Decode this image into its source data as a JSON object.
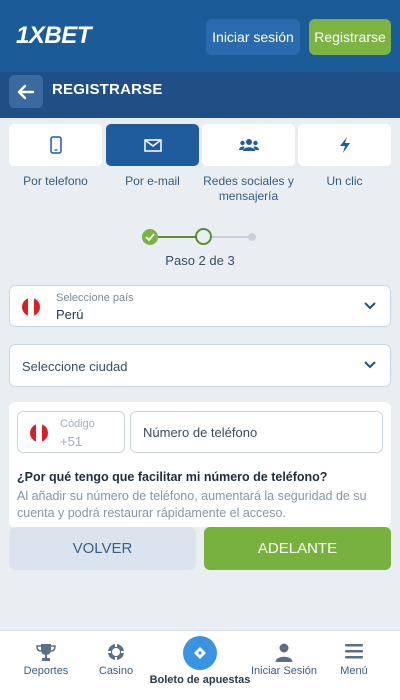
{
  "header": {
    "logo": "1XBET",
    "login_label": "Iniciar sesión",
    "register_label": "Registrarse"
  },
  "titlebar": {
    "title": "REGISTRARSE"
  },
  "tabs": [
    {
      "label": "Por telefono",
      "icon": "phone-icon",
      "active": false
    },
    {
      "label": "Por e-mail",
      "icon": "envelope-icon",
      "active": true
    },
    {
      "label": "Redes sociales y mensajería",
      "icon": "users-icon",
      "active": false
    },
    {
      "label": "Un clic",
      "icon": "lightning-icon",
      "active": false
    }
  ],
  "stepper": {
    "text": "Paso 2 de 3",
    "current": 2,
    "total": 3
  },
  "country": {
    "label": "Seleccione país",
    "value": "Perú"
  },
  "city": {
    "placeholder": "Seleccione ciudad"
  },
  "phone": {
    "code_label": "Código",
    "code_value": "+51",
    "number_placeholder": "Número de teléfono",
    "why_title": "¿Por qué tengo que facilitar mi número de teléfono?",
    "why_text": "Al añadir su número de teléfono, aumentará la seguridad de su cuenta y podrá restaurar rápidamente el acceso."
  },
  "actions": {
    "back_label": "VOLVER",
    "next_label": "ADELANTE"
  },
  "bottom_nav": [
    {
      "label": "Deportes",
      "icon": "trophy-icon"
    },
    {
      "label": "Casino",
      "icon": "casino-chip-icon"
    },
    {
      "label": "Boleto de apuestas",
      "icon": "ticket-icon"
    },
    {
      "label": "Iniciar Sesión",
      "icon": "user-icon"
    },
    {
      "label": "Menú",
      "icon": "menu-icon"
    }
  ],
  "colors": {
    "header_bg": "#1b5c98",
    "titlebar_bg": "#1f4f85",
    "accent_green": "#7cb342",
    "active_tab": "#1f5c9e",
    "flag_red": "#d91f26"
  }
}
